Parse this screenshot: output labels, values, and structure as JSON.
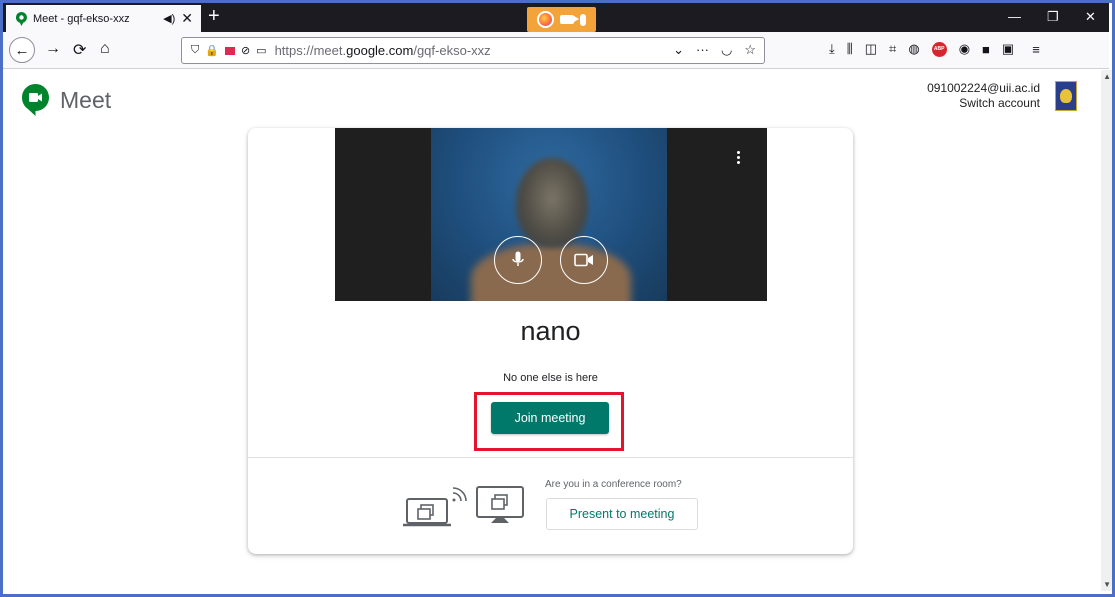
{
  "browser": {
    "tab": {
      "title": "Meet - gqf-ekso-xxz"
    },
    "url": {
      "prefix": "https://meet.",
      "domain": "google.com",
      "path": "/gqf-ekso-xxz"
    }
  },
  "meet": {
    "logo_text": "Meet",
    "account": {
      "email": "091002224@uii.ac.id",
      "switch_label": "Switch account"
    },
    "user_name": "nano",
    "status": "No one else is here",
    "join_label": "Join meeting",
    "conference_question": "Are you in a conference room?",
    "present_label": "Present to meeting"
  },
  "colors": {
    "accent": "#00796b",
    "highlight_box": "#e2152c",
    "browser_chrome": "#1c1b22",
    "sharing_indicator": "#f2a33a"
  }
}
